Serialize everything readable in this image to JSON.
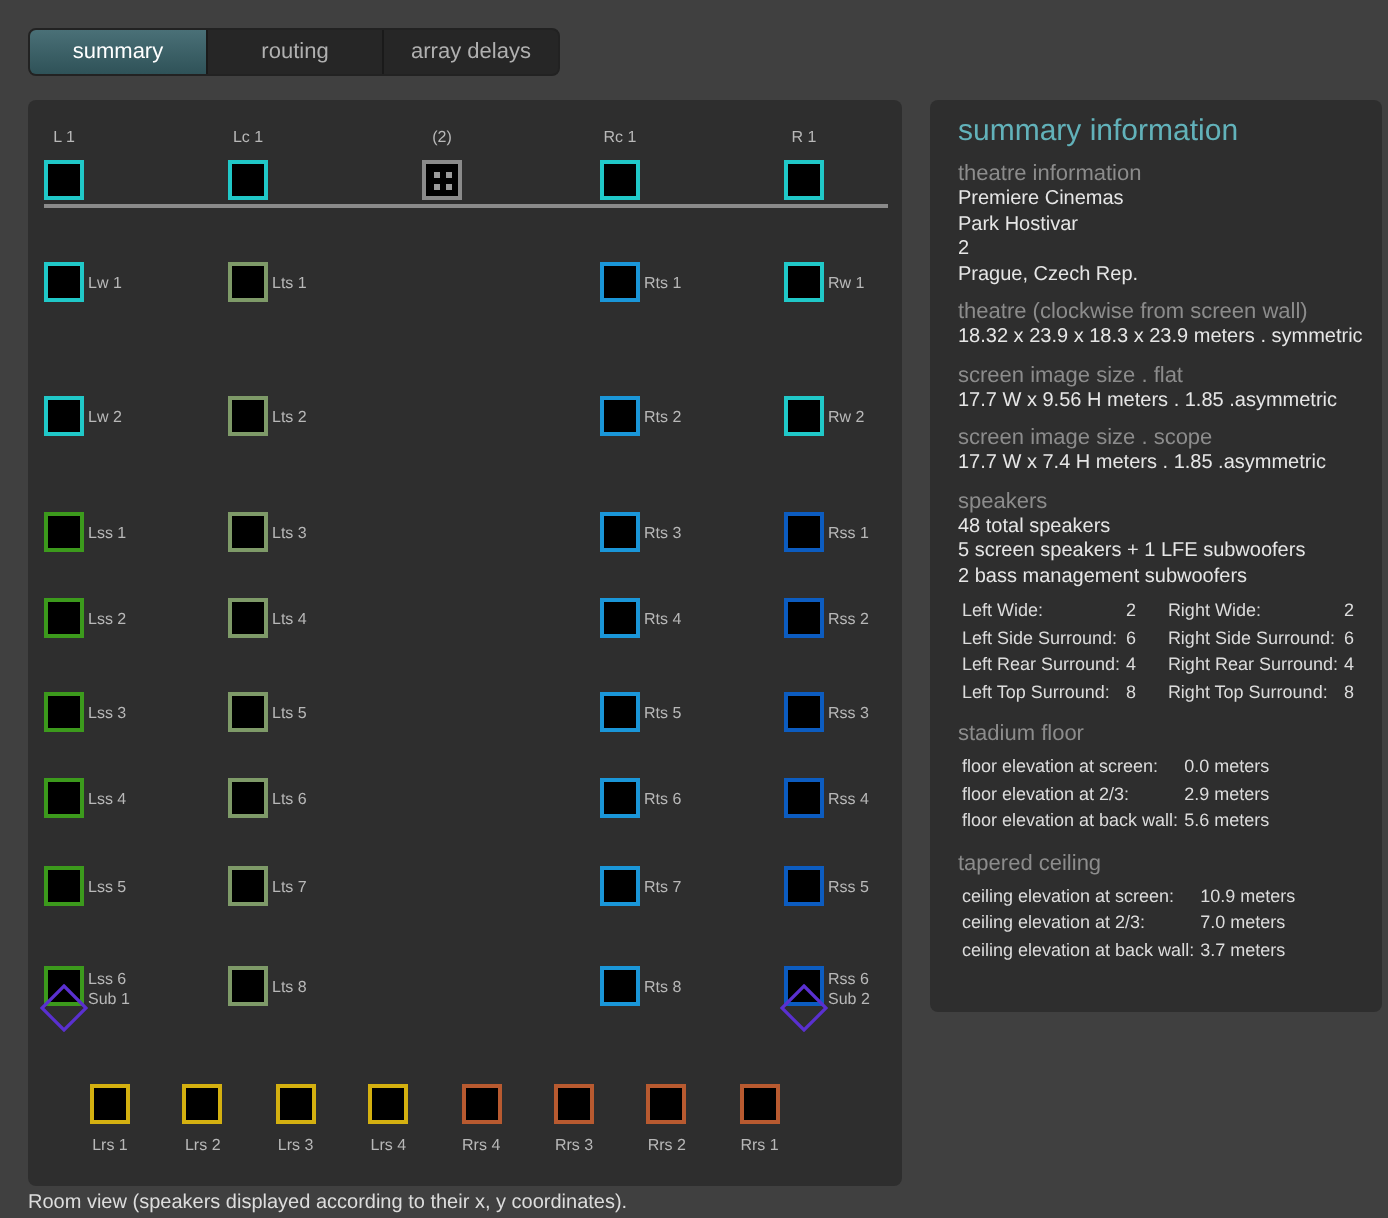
{
  "tabs": [
    {
      "label": "summary",
      "selected": true
    },
    {
      "label": "routing",
      "selected": false
    },
    {
      "label": "array delays",
      "selected": false
    }
  ],
  "room": {
    "screen_speakers": [
      {
        "label": "L 1",
        "kind": "speaker",
        "color": "#20c8c8"
      },
      {
        "label": "Lc 1",
        "kind": "speaker",
        "color": "#20c8c8"
      },
      {
        "label": "(2)",
        "kind": "array",
        "color": "#8a8a8a"
      },
      {
        "label": "Rc 1",
        "kind": "speaker",
        "color": "#20c8c8"
      },
      {
        "label": "R 1",
        "kind": "speaker",
        "color": "#20c8c8"
      }
    ],
    "side_rows": [
      [
        {
          "label": "Lw 1",
          "color": "#20c8c8"
        },
        {
          "label": "Lts 1",
          "color": "#7e9a68"
        },
        {
          "label": "Rts 1",
          "color": "#1a96d8"
        },
        {
          "label": "Rw 1",
          "color": "#20c8c8"
        }
      ],
      [
        {
          "label": "Lw 2",
          "color": "#20c8c8"
        },
        {
          "label": "Lts 2",
          "color": "#7e9a68"
        },
        {
          "label": "Rts 2",
          "color": "#1a96d8"
        },
        {
          "label": "Rw 2",
          "color": "#20c8c8"
        }
      ],
      [
        {
          "label": "Lss 1",
          "color": "#3c9a1c"
        },
        {
          "label": "Lts 3",
          "color": "#7e9a68"
        },
        {
          "label": "Rts 3",
          "color": "#1a96d8"
        },
        {
          "label": "Rss 1",
          "color": "#0c5cc0"
        }
      ],
      [
        {
          "label": "Lss 2",
          "color": "#3c9a1c"
        },
        {
          "label": "Lts 4",
          "color": "#7e9a68"
        },
        {
          "label": "Rts 4",
          "color": "#1a96d8"
        },
        {
          "label": "Rss 2",
          "color": "#0c5cc0"
        }
      ],
      [
        {
          "label": "Lss 3",
          "color": "#3c9a1c"
        },
        {
          "label": "Lts 5",
          "color": "#7e9a68"
        },
        {
          "label": "Rts 5",
          "color": "#1a96d8"
        },
        {
          "label": "Rss 3",
          "color": "#0c5cc0"
        }
      ],
      [
        {
          "label": "Lss 4",
          "color": "#3c9a1c"
        },
        {
          "label": "Lts 6",
          "color": "#7e9a68"
        },
        {
          "label": "Rts 6",
          "color": "#1a96d8"
        },
        {
          "label": "Rss 4",
          "color": "#0c5cc0"
        }
      ],
      [
        {
          "label": "Lss 5",
          "color": "#3c9a1c"
        },
        {
          "label": "Lts 7",
          "color": "#7e9a68"
        },
        {
          "label": "Rts 7",
          "color": "#1a96d8"
        },
        {
          "label": "Rss 5",
          "color": "#0c5cc0"
        }
      ],
      [
        {
          "label": "Lss 6",
          "color": "#3c9a1c",
          "sub": {
            "label": "Sub 1",
            "color": "#5a30d0"
          }
        },
        {
          "label": "Lts 8",
          "color": "#7e9a68"
        },
        {
          "label": "Rts 8",
          "color": "#1a96d8"
        },
        {
          "label": "Rss 6",
          "color": "#0c5cc0",
          "sub": {
            "label": "Sub 2",
            "color": "#5a30d0"
          }
        }
      ]
    ],
    "rear_speakers": [
      {
        "label": "Lrs 1",
        "color": "#d4b010"
      },
      {
        "label": "Lrs 2",
        "color": "#d4b010"
      },
      {
        "label": "Lrs 3",
        "color": "#d4b010"
      },
      {
        "label": "Lrs 4",
        "color": "#d4b010"
      },
      {
        "label": "Rrs 4",
        "color": "#b85a30"
      },
      {
        "label": "Rrs 3",
        "color": "#b85a30"
      },
      {
        "label": "Rrs 2",
        "color": "#b85a30"
      },
      {
        "label": "Rrs 1",
        "color": "#b85a30"
      }
    ]
  },
  "summary": {
    "title": "summary information",
    "sections": [
      {
        "heading": "theatre information",
        "kind": "lines",
        "lines": [
          "Premiere Cinemas",
          "Park Hostivar",
          "2",
          "Prague, Czech Rep."
        ]
      },
      {
        "heading": "theatre (clockwise from screen wall)",
        "kind": "lines",
        "lines": [
          "18.32 x 23.9 x 18.3 x 23.9 meters . symmetric"
        ]
      },
      {
        "heading": "screen image size . flat",
        "kind": "lines",
        "lines": [
          "17.7 W x 9.56 H meters . 1.85 .asymmetric"
        ]
      },
      {
        "heading": "screen image size . scope",
        "kind": "lines",
        "lines": [
          "17.7 W x 7.4 H meters . 1.85 .asymmetric"
        ]
      },
      {
        "heading": "speakers",
        "kind": "lines",
        "lines": [
          "48 total speakers",
          "5 screen speakers + 1 LFE subwoofers",
          "2 bass management subwoofers"
        ],
        "counts": [
          {
            "left_label": "Left Wide:",
            "left_value": "2",
            "right_label": "Right Wide:",
            "right_value": "2"
          },
          {
            "left_label": "Left Side Surround:",
            "left_value": "6",
            "right_label": "Right Side Surround:",
            "right_value": "6"
          },
          {
            "left_label": "Left Rear Surround:",
            "left_value": "4",
            "right_label": "Right Rear Surround:",
            "right_value": "4"
          },
          {
            "left_label": "Left Top Surround:",
            "left_value": "8",
            "right_label": "Right Top Surround:",
            "right_value": "8"
          }
        ]
      },
      {
        "heading": "stadium floor",
        "kind": "table",
        "rows": [
          {
            "label": "floor elevation at screen:",
            "value": "0.0 meters"
          },
          {
            "label": "floor elevation at 2/3:",
            "value": "2.9 meters"
          },
          {
            "label": "floor elevation at back wall:",
            "value": "5.6 meters"
          }
        ]
      },
      {
        "heading": "tapered ceiling",
        "kind": "table",
        "rows": [
          {
            "label": "ceiling elevation at screen:",
            "value": "10.9 meters"
          },
          {
            "label": "ceiling elevation at 2/3:",
            "value": "7.0 meters"
          },
          {
            "label": "ceiling elevation at back wall:",
            "value": "3.7 meters"
          }
        ]
      }
    ]
  },
  "status_text": "Room view (speakers displayed according to their x, y coordinates)."
}
